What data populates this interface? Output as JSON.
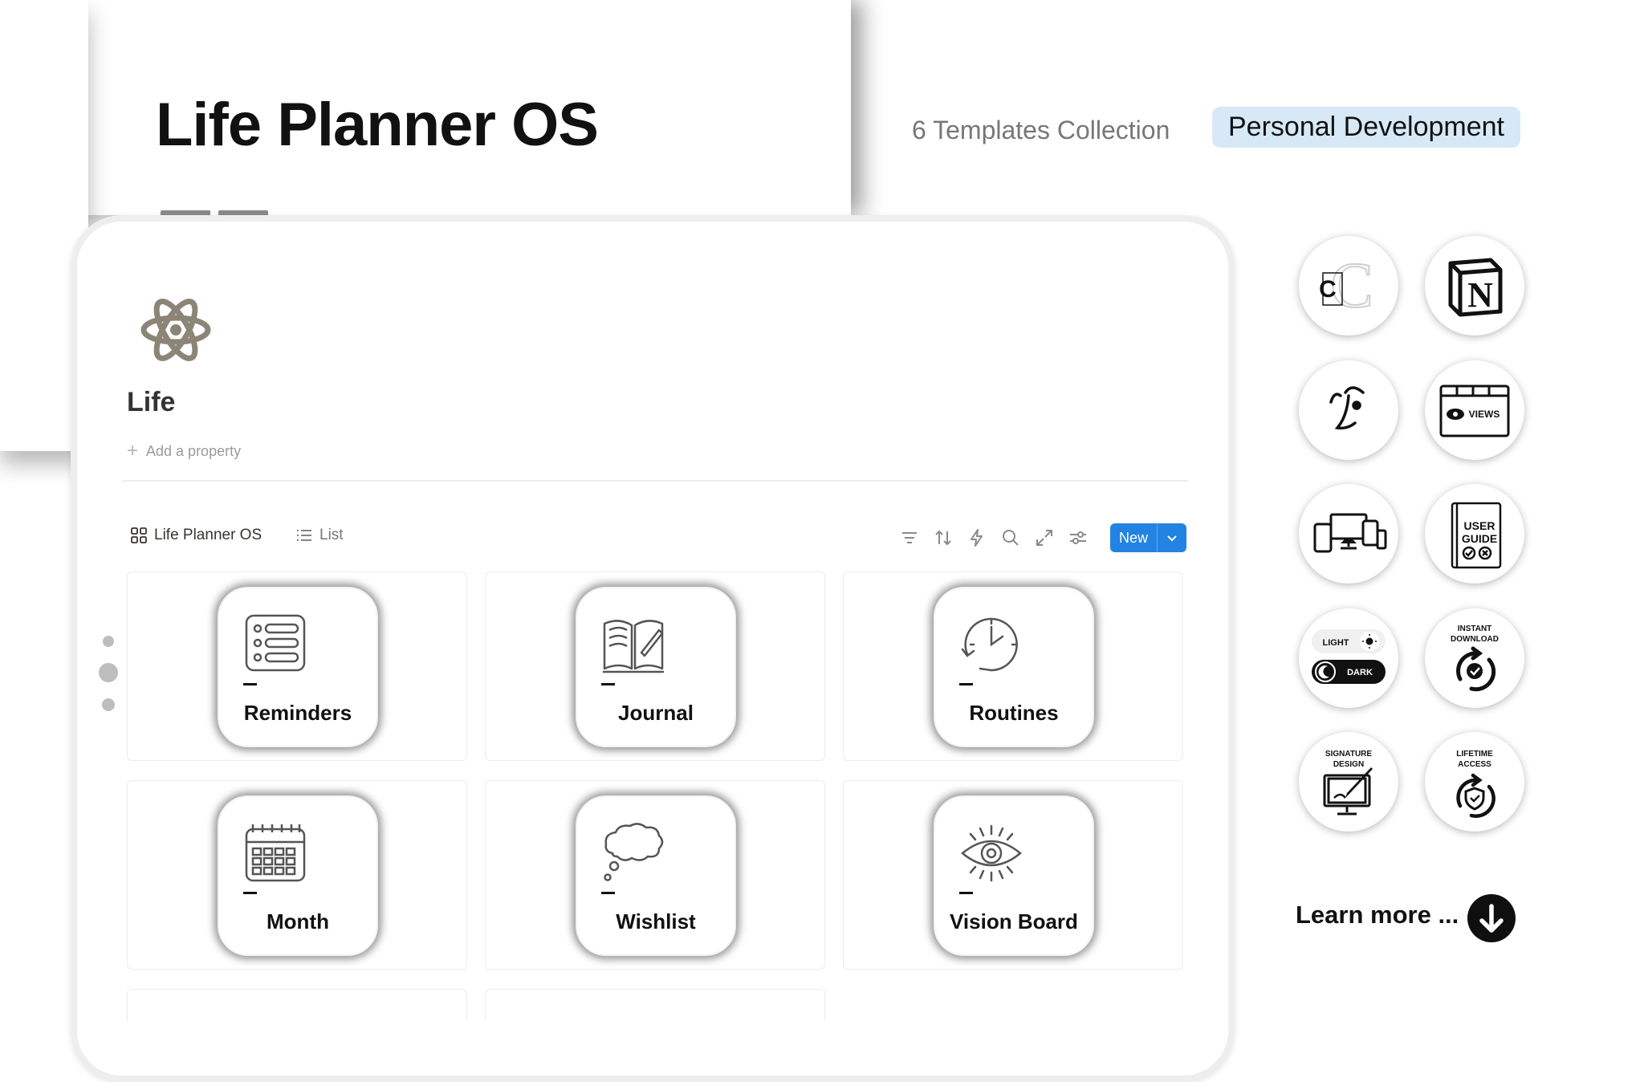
{
  "hero": {
    "title": "Life Planner OS",
    "collection": "6 Templates Collection",
    "category": "Personal Development"
  },
  "notion_page": {
    "icon": "atom-icon",
    "title": "Life",
    "add_property": "Add a property",
    "views": [
      {
        "label": "Life Planner OS",
        "icon": "gallery-icon",
        "active": true
      },
      {
        "label": "List",
        "icon": "list-icon",
        "active": false
      }
    ],
    "toolbar_icons": [
      "filter-icon",
      "sort-icon",
      "automation-icon",
      "search-icon",
      "expand-icon",
      "settings-icon"
    ],
    "new_button": "New",
    "cards": [
      {
        "name": "Reminders",
        "icon": "checklist-icon"
      },
      {
        "name": "Journal",
        "icon": "open-book-icon"
      },
      {
        "name": "Routines",
        "icon": "clock-icon"
      },
      {
        "name": "Month",
        "icon": "calendar-icon"
      },
      {
        "name": "Wishlist",
        "icon": "thought-bubble-icon"
      },
      {
        "name": "Vision Board",
        "icon": "eye-icon"
      }
    ]
  },
  "features": {
    "light": "LIGHT",
    "dark": "DARK",
    "views": "VIEWS",
    "user_guide_1": "USER",
    "user_guide_2": "GUIDE",
    "instant_1": "INSTANT",
    "instant_2": "DOWNLOAD",
    "signature_1": "SIGNATURE",
    "signature_2": "DESIGN",
    "lifetime_1": "LIFETIME",
    "lifetime_2": "ACCESS"
  },
  "learn_more": "Learn more ...",
  "colors": {
    "accent_blue": "#2383e2",
    "badge_blue": "#d7e8f6",
    "icon_gray": "#8c8577"
  }
}
